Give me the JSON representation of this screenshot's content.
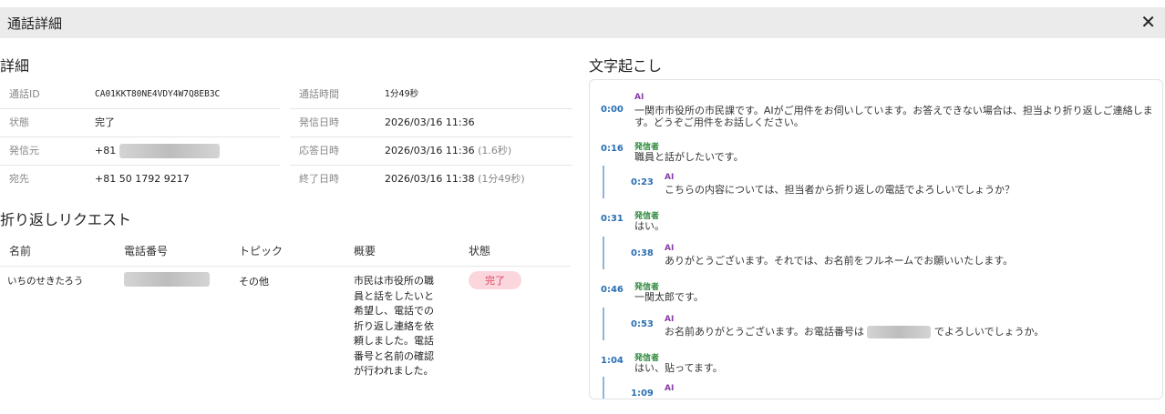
{
  "dialog": {
    "title": "通話詳細",
    "close_glyph": "✕"
  },
  "details": {
    "section_title": "詳細",
    "rows": [
      {
        "label1": "通話ID",
        "value1": "CA01KKT80NE4VDY4W7Q8EB3C",
        "label2": "通話時間",
        "value2": "1分49秒"
      },
      {
        "label1": "状態",
        "value1": "完了",
        "label2": "発信日時",
        "value2": "2026/03/16 11:36"
      },
      {
        "label1": "発信元",
        "value1": "+81",
        "label2": "応答日時",
        "value2": "2026/03/16 11:36",
        "value2_extra": "(1.6秒)"
      },
      {
        "label1": "宛先",
        "value1": "+81 50 1792 9217",
        "label2": "終了日時",
        "value2": "2026/03/16 11:38",
        "value2_extra": "(1分49秒)"
      }
    ]
  },
  "callback": {
    "section_title": "折り返しリクエスト",
    "headers": [
      "名前",
      "電話番号",
      "トピック",
      "概要",
      "状態"
    ],
    "row": {
      "name": "いちのせきたろう",
      "topic": "その他",
      "summary": "市民は市役所の職員と話をしたいと希望し、電話での折り返し連絡を依頼しました。電話番号と名前の確認が行われました。",
      "status": "完了"
    }
  },
  "transcript": {
    "section_title": "文字起こし",
    "messages": [
      {
        "time": "0:00",
        "speaker": "AI",
        "text": "一関市市役所の市民課です。AIがご用件をお伺いしています。お答えできない場合は、担当より折り返しご連絡します。どうぞご用件をお話しください。"
      },
      {
        "time": "0:16",
        "speaker": "発信者",
        "text": "職員と話がしたいです。"
      },
      {
        "time": "0:23",
        "speaker": "AI",
        "text": "こちらの内容については、担当者から折り返しの電話でよろしいでしょうか？"
      },
      {
        "time": "0:31",
        "speaker": "発信者",
        "text": "はい。"
      },
      {
        "time": "0:38",
        "speaker": "AI",
        "text": "ありがとうございます。それでは、お名前をフルネームでお願いいたします。"
      },
      {
        "time": "0:46",
        "speaker": "発信者",
        "text": "一関太郎です。"
      },
      {
        "time": "0:53",
        "speaker": "AI",
        "text_before": "お名前ありがとうございます。お電話番号は",
        "text_after": "でよろしいでしょうか。"
      },
      {
        "time": "1:04",
        "speaker": "発信者",
        "text": "はい、贴ってます。"
      },
      {
        "time": "1:09",
        "speaker": "AI",
        "text": ""
      }
    ]
  },
  "colors": {
    "ai": "#8a3aa8",
    "caller": "#2e8b3e",
    "time": "#2a6fb3",
    "badge_bg": "#fbd6dc",
    "badge_fg": "#d94660"
  }
}
